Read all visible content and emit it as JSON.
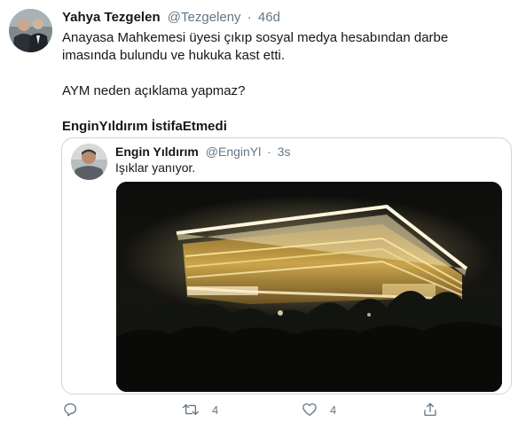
{
  "tweet": {
    "author_name": "Yahya Tezgelen",
    "author_handle": "@Tezgeleny",
    "separator": "·",
    "time": "46d",
    "text_1": "Anayasa Mahkemesi üyesi çıkıp sosyal medya hesabından darbe imasında bulundu ve hukuka kast etti.",
    "text_2": "AYM neden açıklama yapmaz?",
    "text_3": "EnginYıldırım İstifaEtmedi"
  },
  "quoted": {
    "author_name": "Engin Yıldırım",
    "author_handle": "@EnginYl",
    "separator": "·",
    "time": "3s",
    "text": "Işıklar yanıyor."
  },
  "actions": {
    "reply_icon": "reply-icon",
    "retweet_icon": "retweet-icon",
    "retweet_count": "4",
    "like_icon": "heart-icon",
    "like_count": "4",
    "share_icon": "share-icon"
  },
  "colors": {
    "text_primary": "#14171a",
    "text_secondary": "#657786",
    "border": "#ccd6dd"
  }
}
